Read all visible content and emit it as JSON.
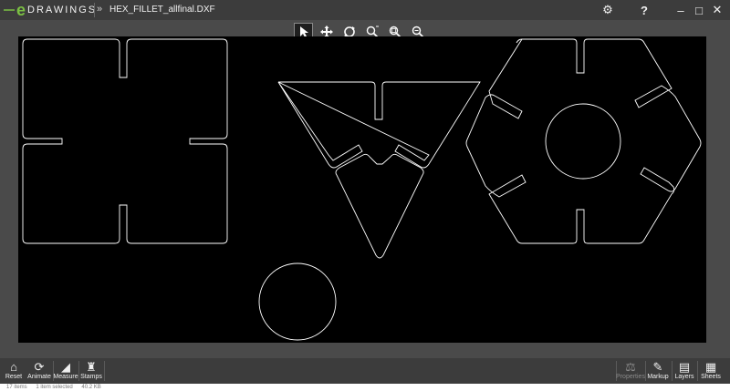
{
  "app": {
    "logo_text": "DRAWINGS",
    "logo_mark": "e",
    "breadcrumb_chevron": "»",
    "file_name": "HEX_FILLET_allfinal.DXF"
  },
  "window_controls": {
    "settings_icon": "gear-icon",
    "help_label": "?",
    "minimize_label": "–",
    "maximize_label": "□",
    "close_label": "✕"
  },
  "view_tools": [
    {
      "name": "select",
      "glyph": "➤"
    },
    {
      "name": "pan",
      "glyph": "✥"
    },
    {
      "name": "rotate",
      "glyph": "⟳"
    },
    {
      "name": "zoom-to-fit",
      "glyph": "⌕"
    },
    {
      "name": "zoom-area",
      "glyph": "⌕"
    },
    {
      "name": "zoom-in-out",
      "glyph": "⌕"
    }
  ],
  "bottom_left_buttons": [
    {
      "label": "Reset",
      "icon": "home-icon"
    },
    {
      "label": "Animate",
      "icon": "animate-icon"
    },
    {
      "label": "Measure",
      "icon": "measure-icon"
    },
    {
      "label": "Stamps",
      "icon": "stamp-icon"
    }
  ],
  "bottom_right_buttons": [
    {
      "label": "Properties",
      "icon": "balance-icon",
      "disabled": true
    },
    {
      "label": "Markup",
      "icon": "pencil-icon"
    },
    {
      "label": "Layers",
      "icon": "layers-icon"
    },
    {
      "label": "Sheets",
      "icon": "sheets-icon"
    }
  ],
  "status": {
    "items": "17 items",
    "selected": "1 item selected",
    "size": "40.2 KB"
  },
  "colors": {
    "titlebar": "#3c3c3c",
    "canvas": "#000000",
    "drawing_lines": "#ffffff",
    "logo_accent": "#7bc043"
  }
}
